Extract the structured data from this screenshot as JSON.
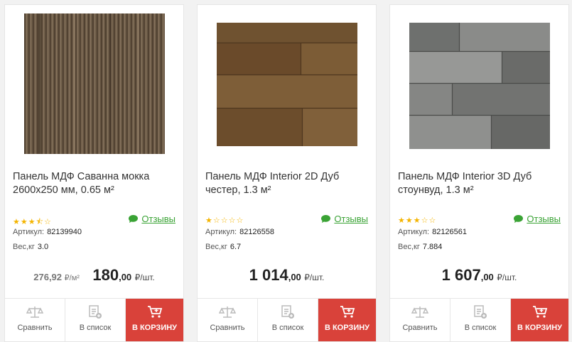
{
  "products": [
    {
      "title": "Панель МДФ Саванна мокка 2600x250 мм, 0.65 м²",
      "rating": 3.5,
      "rating_stars": "★★★⯪☆",
      "reviews_label": "Отзывы",
      "article_label": "Артикул:",
      "article": "82139940",
      "weight_label": "Вес,кг",
      "weight": "3.0",
      "old_price": "276,92",
      "old_unit": "₽/м²",
      "price": "180",
      "cents": ",00",
      "unit": "₽/шт.",
      "compare_label": "Сравнить",
      "list_label": "В список",
      "cart_label": "В КОРЗИНУ",
      "image": "mdf-savanna-mocha-texture"
    },
    {
      "title": "Панель МДФ Interior 2D Дуб честер, 1.3 м²",
      "rating": 1,
      "rating_stars": "★☆☆☆☆",
      "reviews_label": "Отзывы",
      "article_label": "Артикул:",
      "article": "82126558",
      "weight_label": "Вес,кг",
      "weight": "6.7",
      "price": "1 014",
      "cents": ",00",
      "unit": "₽/шт.",
      "compare_label": "Сравнить",
      "list_label": "В список",
      "cart_label": "В КОРЗИНУ",
      "image": "oak-chester-planks"
    },
    {
      "title": "Панель МДФ Interior 3D Дуб стоунвуд, 1.3 м²",
      "rating": 3,
      "rating_stars": "★★★☆☆",
      "reviews_label": "Отзывы",
      "article_label": "Артикул:",
      "article": "82126561",
      "weight_label": "Вес,кг",
      "weight": "7.884",
      "price": "1 607",
      "cents": ",00",
      "unit": "₽/шт.",
      "compare_label": "Сравнить",
      "list_label": "В список",
      "cart_label": "В КОРЗИНУ",
      "image": "oak-stonewood-3d-planks"
    }
  ],
  "colors": {
    "accent_red": "#d9423a",
    "link_green": "#3aa335",
    "star": "#f4b400"
  }
}
